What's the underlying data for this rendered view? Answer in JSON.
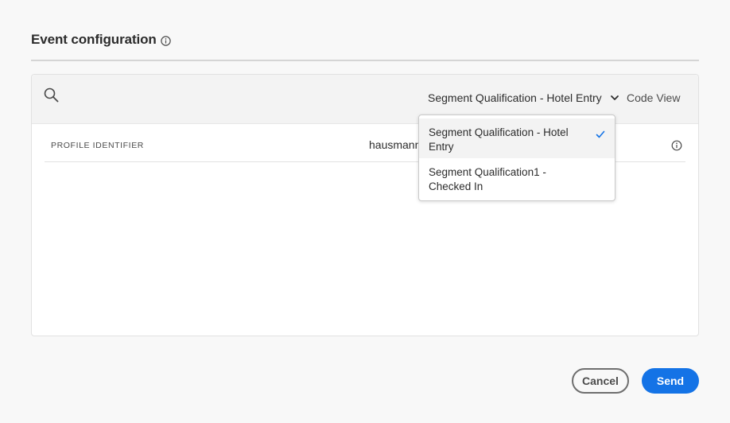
{
  "header": {
    "title": "Event configuration",
    "info_icon": "info-icon"
  },
  "toolbar": {
    "search_icon": "search-icon",
    "selected_event": "Segment Qualification - Hotel Entry",
    "dropdown_icon": "chevron-down-icon",
    "code_view_label": "Code View"
  },
  "table": {
    "rows": [
      {
        "label": "PROFILE IDENTIFIER",
        "value": "hausmann-",
        "info_icon": "info-icon"
      }
    ]
  },
  "dropdown": {
    "options": [
      {
        "label": "Segment Qualification - Hotel Entry",
        "selected": true
      },
      {
        "label": "Segment Qualification1 - Checked In",
        "selected": false
      }
    ],
    "check_icon": "checkmark-icon"
  },
  "footer": {
    "cancel_label": "Cancel",
    "send_label": "Send"
  },
  "colors": {
    "accent": "#1473e6",
    "background": "#f8f8f8",
    "panel_background": "#ffffff",
    "toolbar_background": "#f3f3f3"
  }
}
